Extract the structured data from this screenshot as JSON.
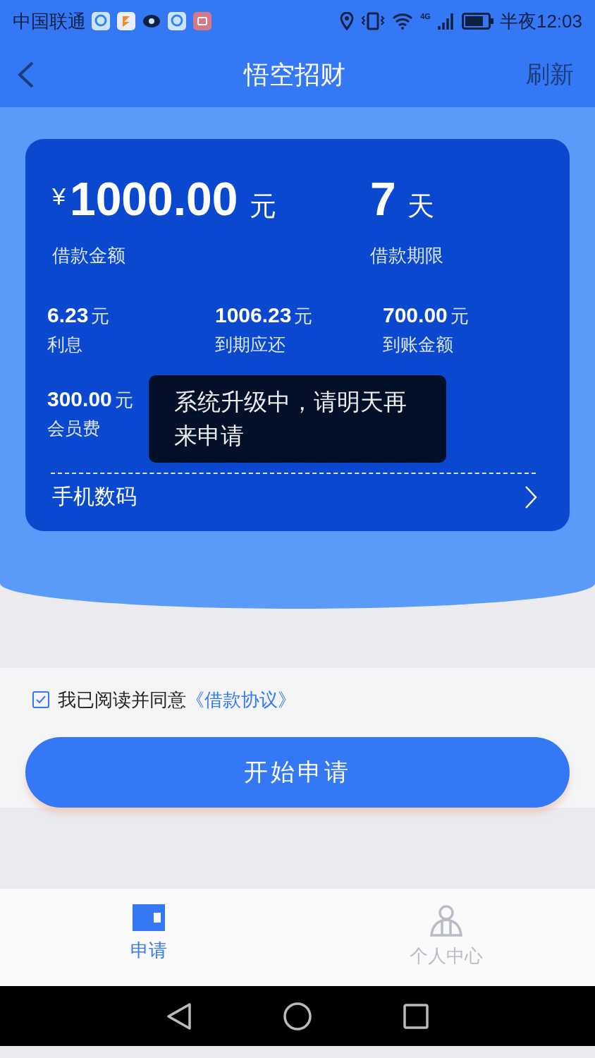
{
  "status_bar": {
    "carrier": "中国联通",
    "network": "4G",
    "time": "半夜12:03"
  },
  "header": {
    "title": "悟空招财",
    "action": "刷新"
  },
  "loan": {
    "currency": "¥",
    "amount": "1000.00",
    "amount_unit": "元",
    "amount_label": "借款金额",
    "term": "7",
    "term_unit": "天",
    "term_label": "借款期限"
  },
  "details": [
    {
      "value": "6.23",
      "unit": "元",
      "label": "利息"
    },
    {
      "value": "1006.23",
      "unit": "元",
      "label": "到期应还"
    },
    {
      "value": "700.00",
      "unit": "元",
      "label": "到账金额"
    },
    {
      "value": "300.00",
      "unit": "元",
      "label": "会员费"
    }
  ],
  "phone_row": {
    "label": "手机数码"
  },
  "toast": "系统升级中，请明天再来申请",
  "agreement": {
    "checked": true,
    "text": "我已阅读并同意",
    "link": "《借款协议》"
  },
  "submit": "开始申请",
  "tabs": [
    {
      "label": "申请",
      "selected": true
    },
    {
      "label": "个人中心",
      "selected": false
    }
  ]
}
